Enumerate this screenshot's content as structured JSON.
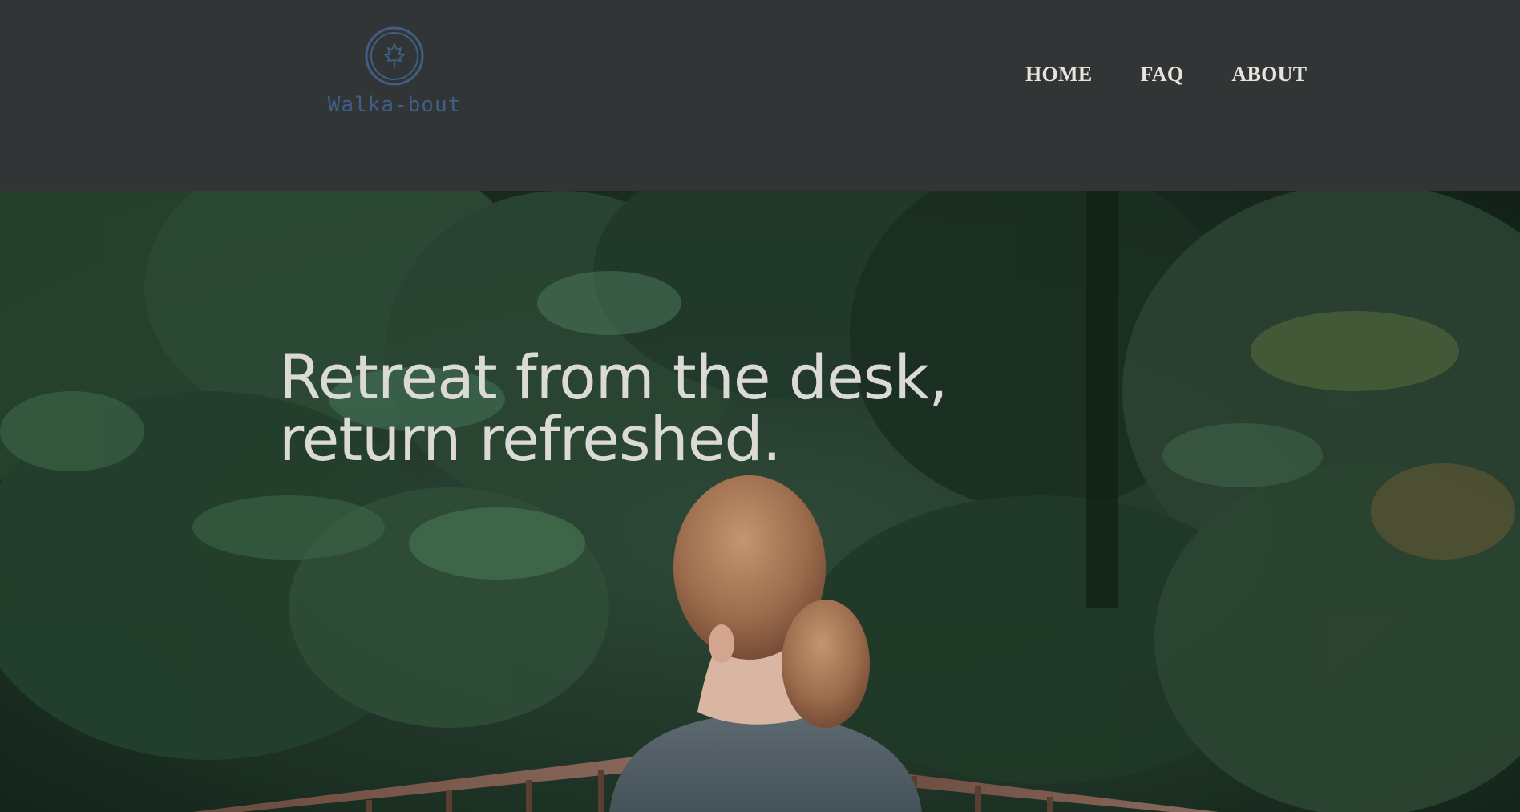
{
  "brand": {
    "name": "Walka-bout",
    "logo_color": "#3f5f86"
  },
  "nav": {
    "items": [
      {
        "label": "HOME"
      },
      {
        "label": "FAQ"
      },
      {
        "label": "ABOUT"
      }
    ]
  },
  "hero": {
    "headline_line1": "Retreat from the desk,",
    "headline_line2": "return refreshed.",
    "image_description_icon": "forest-bridge-woman-photo"
  },
  "colors": {
    "header_bg": "#323535",
    "nav_text": "#e7e2da",
    "headline_text": "#dcdad7"
  }
}
